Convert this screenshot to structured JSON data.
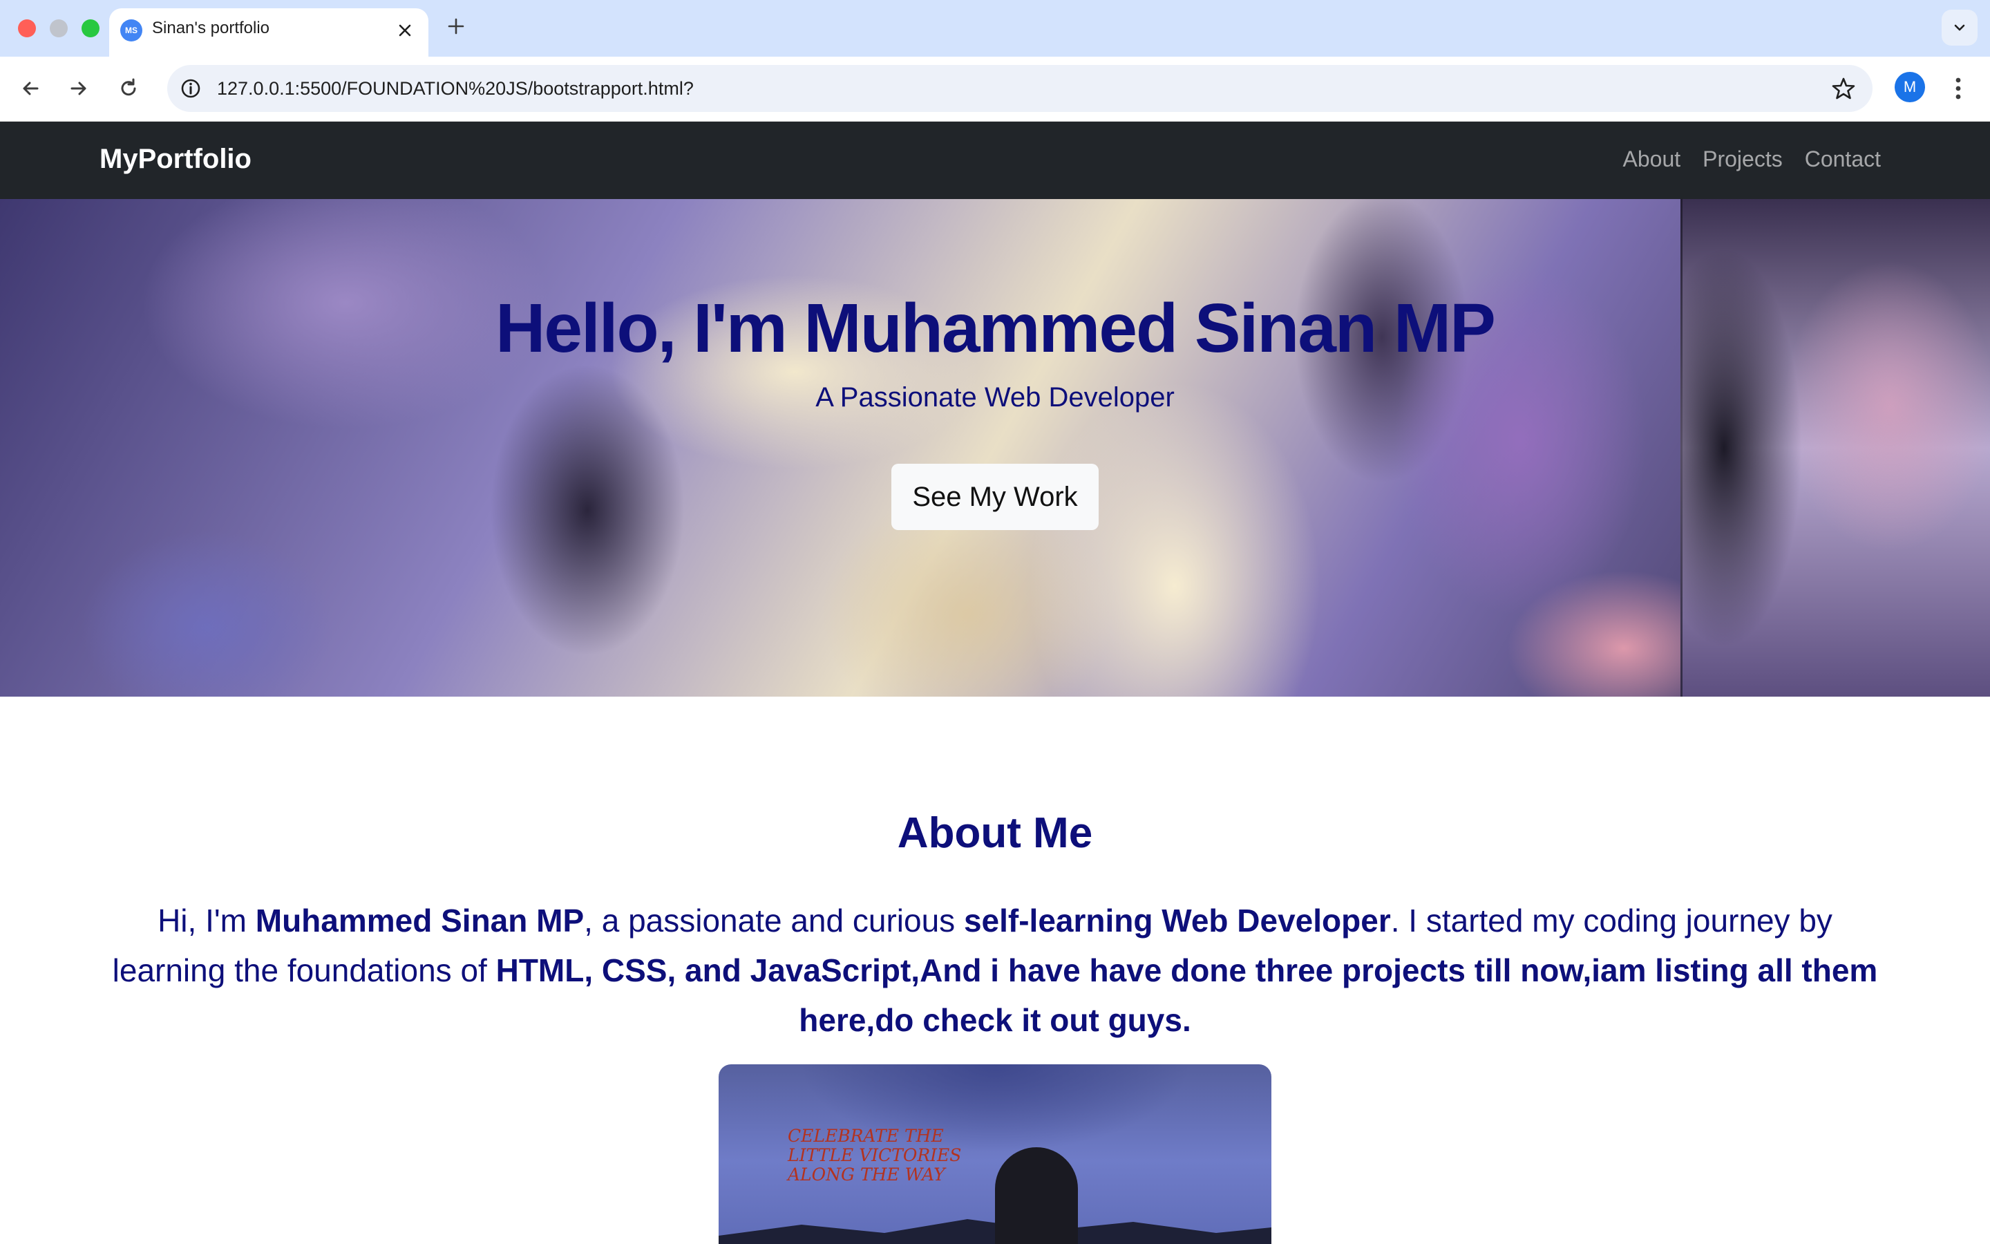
{
  "browser": {
    "tab": {
      "favicon_text": "MS",
      "title": "Sinan's portfolio"
    },
    "url": "127.0.0.1:5500/FOUNDATION%20JS/bootstrapport.html?",
    "profile_initial": "M"
  },
  "navbar": {
    "brand": "MyPortfolio",
    "links": [
      "About",
      "Projects",
      "Contact"
    ]
  },
  "hero": {
    "greeting": "Hello, I'm ",
    "name": "Muhammed Sinan MP",
    "subtitle": "A Passionate Web Developer",
    "button": "See My Work"
  },
  "about": {
    "title": "About Me",
    "text": {
      "p1": "Hi, I'm ",
      "name": "Muhammed Sinan MP",
      "p2": ", a passionate and curious ",
      "role": "self-learning Web Developer",
      "p3": ". I started my coding journey by learning the foundations of ",
      "tail": "HTML, CSS, and JavaScript,And i have have done three projects till now,iam listing all them here,do check it out guys."
    },
    "photo_caption": "Celebrate the little victories along the way"
  },
  "colors": {
    "navbar_bg": "#212529",
    "accent_text": "#0d0f7a",
    "tabstrip_bg": "#d3e3fd"
  }
}
